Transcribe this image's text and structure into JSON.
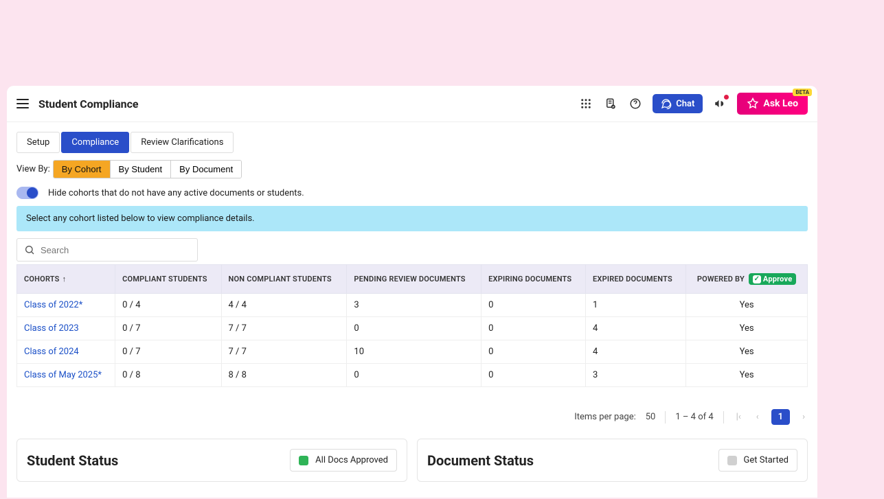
{
  "header": {
    "title": "Student Compliance",
    "chat_label": "Chat",
    "askleo_label": "Ask Leo",
    "beta_label": "BETA"
  },
  "tabs": {
    "setup": "Setup",
    "compliance": "Compliance",
    "review": "Review Clarifications"
  },
  "viewby": {
    "label": "View By:",
    "cohort": "By Cohort",
    "student": "By Student",
    "document": "By Document"
  },
  "toggle": {
    "label": "Hide cohorts that do not have any active documents or students."
  },
  "banner": {
    "text": "Select any cohort listed below to view compliance details."
  },
  "search": {
    "placeholder": "Search"
  },
  "table": {
    "headers": {
      "cohorts": "COHORTS",
      "compliant": "COMPLIANT STUDENTS",
      "noncompliant": "NON COMPLIANT STUDENTS",
      "pending": "PENDING REVIEW DOCUMENTS",
      "expiring": "EXPIRING DOCUMENTS",
      "expired": "EXPIRED DOCUMENTS",
      "powered": "POWERED BY",
      "approve_badge": "Approve"
    },
    "rows": [
      {
        "cohort": "Class of 2022*",
        "compliant": "0 / 4",
        "noncompliant": "4 / 4",
        "pending": "3",
        "expiring": "0",
        "expired": "1",
        "powered": "Yes"
      },
      {
        "cohort": "Class of 2023",
        "compliant": "0 / 7",
        "noncompliant": "7 / 7",
        "pending": "0",
        "expiring": "0",
        "expired": "4",
        "powered": "Yes"
      },
      {
        "cohort": "Class of 2024",
        "compliant": "0 / 7",
        "noncompliant": "7 / 7",
        "pending": "10",
        "expiring": "0",
        "expired": "4",
        "powered": "Yes"
      },
      {
        "cohort": "Class of May 2025*",
        "compliant": "0 / 8",
        "noncompliant": "8 / 8",
        "pending": "0",
        "expiring": "0",
        "expired": "3",
        "powered": "Yes"
      }
    ]
  },
  "pagination": {
    "items_per_page_label": "Items per page:",
    "items_per_page_value": "50",
    "range": "1 – 4 of 4",
    "page": "1"
  },
  "panels": {
    "student_status": "Student Status",
    "student_legend": "All Docs Approved",
    "document_status": "Document Status",
    "document_legend": "Get Started"
  }
}
